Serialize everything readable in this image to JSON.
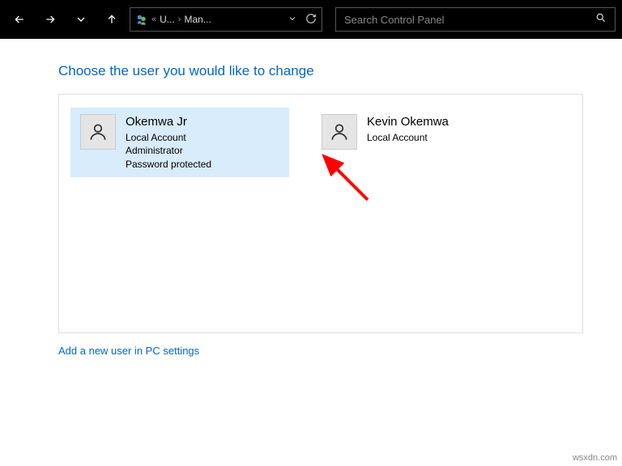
{
  "breadcrumb": {
    "seg1": "U...",
    "seg2": "Man..."
  },
  "search": {
    "placeholder": "Search Control Panel"
  },
  "heading": "Choose the user you would like to change",
  "users": [
    {
      "name": "Okemwa Jr",
      "line1": "Local Account",
      "line2": "Administrator",
      "line3": "Password protected"
    },
    {
      "name": "Kevin Okemwa",
      "line1": "Local Account",
      "line2": "",
      "line3": ""
    }
  ],
  "addLink": "Add a new user in PC settings",
  "watermark": "wsxdn.com"
}
